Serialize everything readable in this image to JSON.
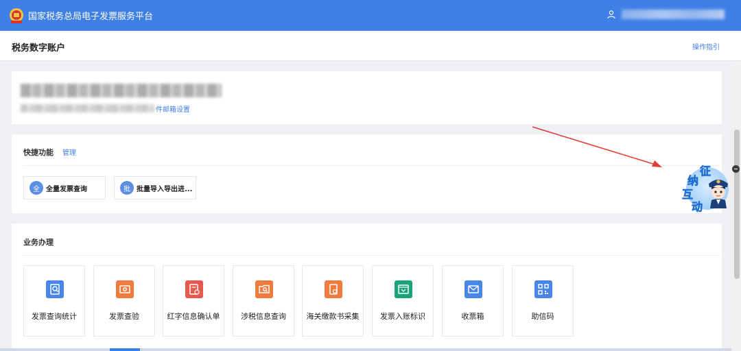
{
  "header": {
    "platform_title": "国家税务总局电子发票服务平台",
    "logo_icon": "tax-emblem-icon",
    "user_icon": "user-icon"
  },
  "subheader": {
    "page_title": "税务数字账户",
    "guide_link": "操作指引"
  },
  "account": {
    "email_settings_link": "件邮箱设置"
  },
  "quick_functions": {
    "title": "快捷功能",
    "manage_link": "管理",
    "items": [
      {
        "badge": "全",
        "label": "全量发票查询"
      },
      {
        "badge": "批",
        "label": "批量导入导出进..."
      }
    ]
  },
  "business": {
    "title": "业务办理",
    "tiles": [
      {
        "label": "发票查询统计",
        "icon": "invoice-search-icon",
        "color": "#4a86e8"
      },
      {
        "label": "发票查验",
        "icon": "invoice-verify-icon",
        "color": "#f07b3f"
      },
      {
        "label": "红字信息确认单",
        "icon": "red-letter-confirm-icon",
        "color": "#e55a4e"
      },
      {
        "label": "涉税信息查询",
        "icon": "tax-info-search-icon",
        "color": "#f07b3f"
      },
      {
        "label": "海关缴款书采集",
        "icon": "customs-payment-icon",
        "color": "#f07b3f"
      },
      {
        "label": "发票入账标识",
        "icon": "invoice-accounting-icon",
        "color": "#1aa37a"
      },
      {
        "label": "收票箱",
        "icon": "mailbox-icon",
        "color": "#4a86e8"
      },
      {
        "label": "助信码",
        "icon": "qr-code-icon",
        "color": "#4a86e8"
      }
    ]
  },
  "helper": {
    "chars": [
      "征",
      "纳",
      "互",
      "动"
    ]
  },
  "colors": {
    "brand": "#3f80e6",
    "link": "#3f7ee8",
    "annotation_arrow": "#e53935"
  }
}
